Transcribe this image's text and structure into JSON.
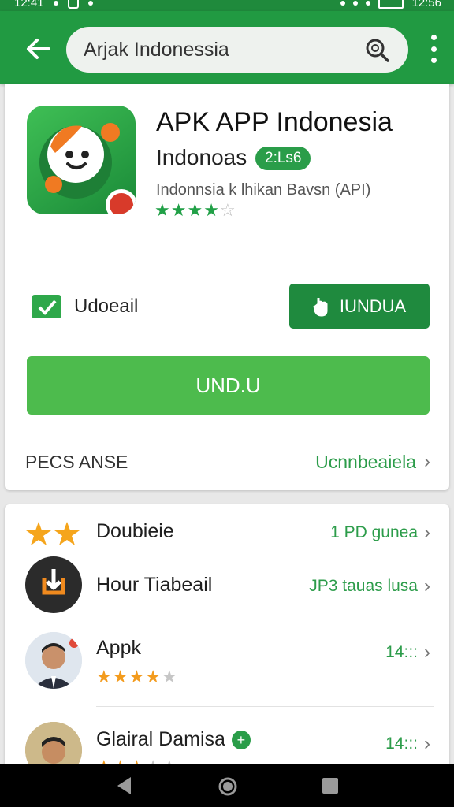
{
  "status_bar": {
    "time_left": "12:41",
    "time_right": "12:56"
  },
  "app_bar": {
    "search_value": "Arjak Indonessia"
  },
  "app": {
    "title": "APK APP Indonesia",
    "developer": "Indonoas",
    "version_badge": "2:Ls6",
    "subtitle": "Indonnsia k lhikan Bavsn (API)",
    "rating": 4,
    "rating_max": 5
  },
  "actions": {
    "update_label": "Udoeail",
    "small_button_label": "IUNDUA",
    "big_button_label": "UND.U"
  },
  "info": {
    "key": "PECS ANSE",
    "value": "Ucnnbeaiela"
  },
  "list": [
    {
      "name": "Doubieie",
      "meta": "1 PD gunea",
      "icon": "two-stars-icon"
    },
    {
      "name": "Hour Tiabeail",
      "meta": "JP3 tauas lusa",
      "icon": "download-app-icon"
    },
    {
      "name": "Appk",
      "meta": "14:::",
      "rating": 4
    },
    {
      "name": "Glairal Damisa",
      "meta": "14:::",
      "rating": 3,
      "verified": true
    }
  ],
  "colors": {
    "primary": "#219a42",
    "accent_green": "#4dbb4d",
    "star_orange": "#f39b1d"
  }
}
